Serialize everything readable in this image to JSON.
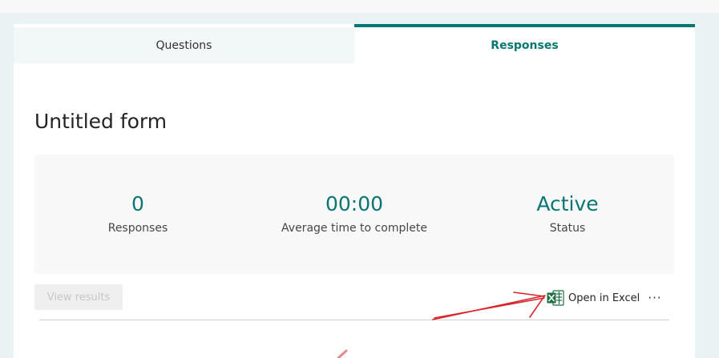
{
  "tabs": {
    "questions": "Questions",
    "responses": "Responses"
  },
  "form": {
    "title": "Untitled form"
  },
  "stats": {
    "responses": {
      "value": "0",
      "label": "Responses"
    },
    "average_time": {
      "value": "00:00",
      "label": "Average time to complete"
    },
    "status": {
      "value": "Active",
      "label": "Status"
    }
  },
  "actions": {
    "view_results": "View results",
    "open_in_excel": "Open in Excel",
    "more": "···"
  },
  "icons": {
    "excel": "excel-icon",
    "more": "more-icon"
  },
  "colors": {
    "accent": "#077672",
    "annotation_arrow": "#d9232a",
    "excel_green": "#1d6f42"
  }
}
